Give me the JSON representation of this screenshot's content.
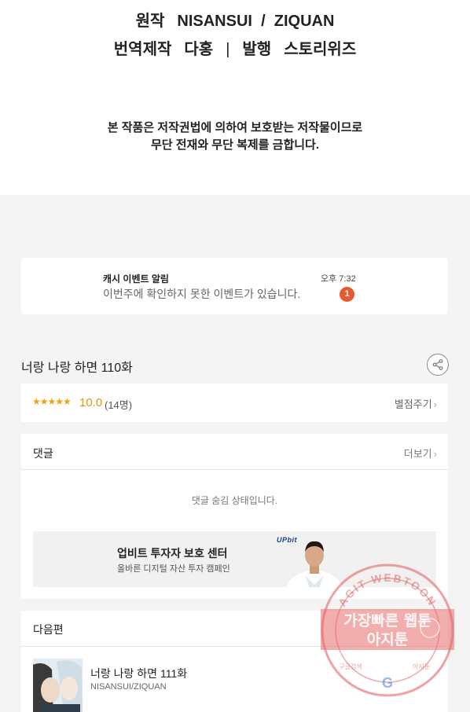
{
  "credits": {
    "original_label": "원작",
    "original_value": "NISANSUI  /  ZIQUAN",
    "translation_label": "번역제작",
    "translation_value": "다홍",
    "separator": "|",
    "publisher_label": "발행",
    "publisher_value": "스토리위즈"
  },
  "copyright": {
    "line1": "본 작품은 저작권법에 의하여 보호받는 저작물이므로",
    "line2": "무단 전재와 무단 복제를 금합니다."
  },
  "notification": {
    "title": "캐시 이벤트 알림",
    "message": "이번주에 확인하지 못한 이벤트가 있습니다.",
    "time": "오후 7:32",
    "badge": "1"
  },
  "episode": {
    "title": "너랑 나랑 하면 110화",
    "stars": "★★★★★",
    "score": "10.0",
    "count": "(14명)",
    "rate_label": "별점주기"
  },
  "comments": {
    "title": "댓글",
    "more_label": "더보기",
    "hidden_message": "댓글 숨김 상태입니다."
  },
  "ad": {
    "title": "업비트 투자자 보호 센터",
    "subtitle": "올바른 디지털 자산 투자 캠페인",
    "logo": "UPbit"
  },
  "next": {
    "header": "다음편",
    "episode_title": "너랑 나랑 하면 111화",
    "author": "NISANSUI/ZIQUAN"
  },
  "watermark": {
    "top_text": "AGIT WEBTOON",
    "line1": "가장빠른 웹툰",
    "line2": "아지툰",
    "bottom_left": "구글검색",
    "bottom_right": "아지툰"
  },
  "colors": {
    "accent_orange": "#e9920a",
    "badge_red": "#e8572e",
    "stamp_red": "#e05a5a"
  }
}
